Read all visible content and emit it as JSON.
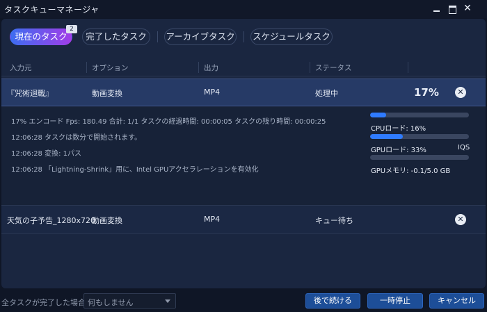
{
  "window": {
    "title": "タスクキューマネージャ"
  },
  "tabs": [
    {
      "label": "現在のタスク",
      "badge": "2"
    },
    {
      "label": "完了したタスク"
    },
    {
      "label": "アーカイブタスク"
    },
    {
      "label": "スケジュールタスク"
    }
  ],
  "columns": [
    "入力元",
    "オプション",
    "出力",
    "ステータス"
  ],
  "tasks": [
    {
      "source": "『咒術迴戰』",
      "option": "動画変換",
      "output": "MP4",
      "status": "処理中",
      "progress": "17%"
    },
    {
      "source": "天気の子予告_1280x720",
      "option": "動画変換",
      "output": "MP4",
      "status": "キュー待ち"
    }
  ],
  "log": [
    "17% エンコード Fps: 180.49  合計: 1/1 タスクの経過時間: 00:00:05 タスクの残り時間: 00:00:25",
    "12:06:28 タスクは数分で開始されます。",
    "12:06:28 変換: 1パス",
    "12:06:28 「Lightning-Shrink」用に、Intel GPUアクセラレーションを有効化"
  ],
  "metrics": {
    "cpu": {
      "label": "CPUロード: 16%",
      "value": 0.16
    },
    "gpu": {
      "label": "GPUロード: 33%",
      "value": 0.33,
      "extra": "IQS"
    },
    "gpu_mem": {
      "label": "GPUメモリ: -0.1/5.0 GB",
      "value": 0.0
    }
  },
  "footer": {
    "when_done_label": "全タスクが完了した場合:",
    "when_done_value": "何もしません",
    "continue_later": "後で続ける",
    "pause": "一時停止",
    "cancel": "キャンセル"
  },
  "colors": {
    "accent": "#2f7bff",
    "tab_gradient_start": "#3d6df0",
    "tab_gradient_end": "#a13de8",
    "button": "#1d4e98"
  }
}
